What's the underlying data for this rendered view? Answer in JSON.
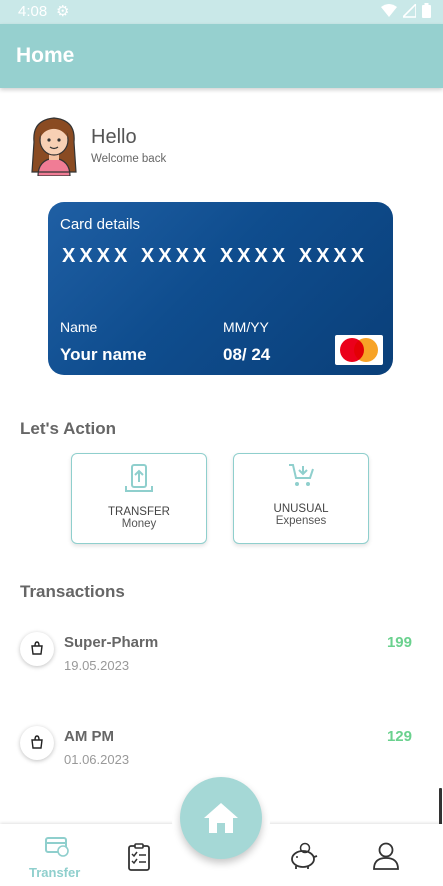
{
  "status_bar": {
    "time": "4:08"
  },
  "app_bar": {
    "title": "Home"
  },
  "greeting": {
    "hello": "Hello",
    "subtitle": "Welcome back"
  },
  "card": {
    "title": "Card details",
    "number": "XXXX XXXX XXXX XXXX",
    "name_label": "Name",
    "name_value": "Your name",
    "expiry_label": "MM/YY",
    "expiry_value": "08/ 24",
    "brand_icon": "mastercard-icon"
  },
  "actions": {
    "title": "Let's Action",
    "items": [
      {
        "line1": "TRANSFER",
        "line2": "Money",
        "icon": "transfer-icon"
      },
      {
        "line1": "UNUSUAL",
        "line2": "Expenses",
        "icon": "cart-icon"
      }
    ]
  },
  "transactions": {
    "title": "Transactions",
    "items": [
      {
        "name": "Super-Pharm",
        "date": "19.05.2023",
        "amount": "199"
      },
      {
        "name": "AM PM",
        "date": "01.06.2023",
        "amount": "129"
      }
    ]
  },
  "bottom_nav": {
    "active_label": "Transfer",
    "items": [
      "transfer-icon",
      "clipboard-icon",
      "home-icon",
      "piggy-bank-icon",
      "profile-icon"
    ]
  },
  "colors": {
    "teal": "#96d0cf",
    "card_blue": "#0f4d8e",
    "amount_green": "#6ad18e"
  }
}
